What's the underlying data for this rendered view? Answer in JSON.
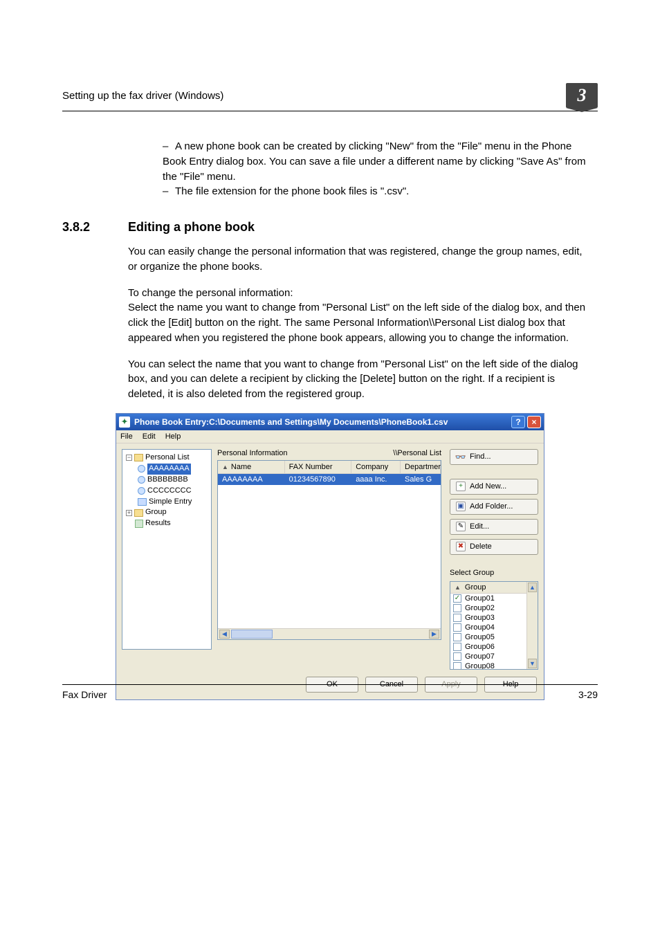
{
  "doc": {
    "header_title": "Setting up the fax driver (Windows)",
    "chapter_number": "3",
    "footer_left": "Fax Driver",
    "footer_right": "3-29",
    "notes": [
      "A new phone book can be created by clicking \"New\" from the \"File\" menu in the Phone Book Entry dialog box. You can save a file under a different name by clicking \"Save As\" from the \"File\" menu.",
      "The file extension for the phone book files is \".csv\"."
    ],
    "section_number": "3.8.2",
    "section_title": "Editing a phone book",
    "paragraphs": [
      "You can easily change the personal information that was registered, change the group names, edit, or organize the phone books.",
      "To change the personal information:\nSelect the name you want to change from \"Personal List\" on the left side of the dialog box, and then click the [Edit] button on the right. The same Personal Information\\\\Personal List dialog box that appeared when you registered the phone book appears, allowing you to change the information.",
      "You can select the name that you want to change from \"Personal List\" on the left side of the dialog box, and you can delete a recipient by clicking the [Delete] button on the right. If a recipient is deleted, it is also deleted from the registered group."
    ]
  },
  "shot": {
    "title": "Phone Book Entry:C:\\Documents and Settings\\My Documents\\PhoneBook1.csv",
    "menu": {
      "file": "File",
      "edit": "Edit",
      "help": "Help"
    },
    "tree": {
      "root1": "Personal List",
      "entries": [
        "AAAAAAAA",
        "BBBBBBBB",
        "CCCCCCCC"
      ],
      "simple_entry": "Simple Entry",
      "root2": "Group",
      "results": "Results"
    },
    "labels": {
      "personal_info": "Personal Information",
      "personal_list_path": "\\\\Personal List"
    },
    "columns": {
      "name": "Name",
      "fax": "FAX Number",
      "company": "Company",
      "department": "Departmer"
    },
    "row": {
      "name": "AAAAAAAA",
      "fax": "01234567890",
      "company": "aaaa Inc.",
      "department": "Sales G"
    },
    "buttons": {
      "find": "Find...",
      "add_new": "Add New...",
      "add_folder": "Add Folder...",
      "edit": "Edit...",
      "delete": "Delete"
    },
    "select_group": "Select Group",
    "group_header": "Group",
    "groups": [
      "Group01",
      "Group02",
      "Group03",
      "Group04",
      "Group05",
      "Group06",
      "Group07",
      "Group08"
    ],
    "group_checked_index": 0,
    "dlg": {
      "ok": "OK",
      "cancel": "Cancel",
      "apply": "Apply",
      "help": "Help"
    }
  }
}
